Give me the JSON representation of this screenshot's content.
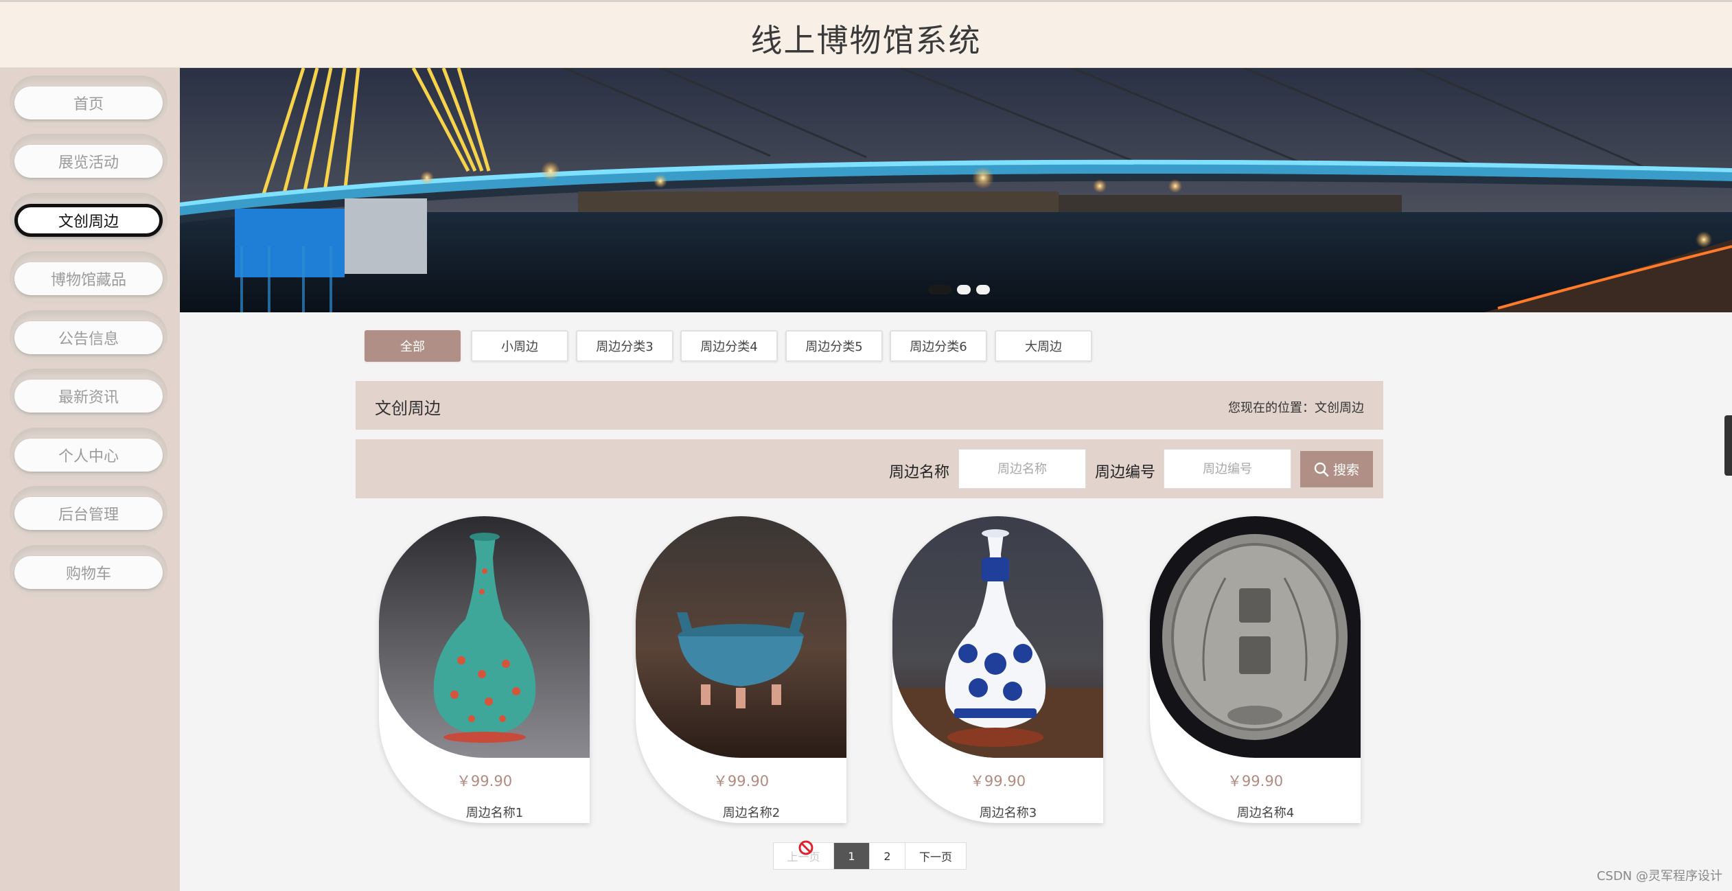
{
  "header": {
    "title": "线上博物馆系统"
  },
  "sidebar": {
    "items": [
      {
        "label": "首页",
        "active": false
      },
      {
        "label": "展览活动",
        "active": false
      },
      {
        "label": "文创周边",
        "active": true
      },
      {
        "label": "博物馆藏品",
        "active": false
      },
      {
        "label": "公告信息",
        "active": false
      },
      {
        "label": "最新资讯",
        "active": false
      },
      {
        "label": "个人中心",
        "active": false
      },
      {
        "label": "后台管理",
        "active": false
      },
      {
        "label": "购物车",
        "active": false
      }
    ]
  },
  "banner": {
    "slide_count": 3,
    "active_slide": 1
  },
  "tabs": [
    {
      "label": "全部",
      "active": true
    },
    {
      "label": "小周边",
      "active": false
    },
    {
      "label": "周边分类3",
      "active": false
    },
    {
      "label": "周边分类4",
      "active": false
    },
    {
      "label": "周边分类5",
      "active": false
    },
    {
      "label": "周边分类6",
      "active": false
    },
    {
      "label": "大周边",
      "active": false
    }
  ],
  "section": {
    "title": "文创周边",
    "breadcrumb": "您现在的位置：文创周边"
  },
  "search": {
    "name_label": "周边名称",
    "name_placeholder": "周边名称",
    "name_value": "",
    "code_label": "周边编号",
    "code_placeholder": "周边编号",
    "code_value": "",
    "button_label": "搜索"
  },
  "products": [
    {
      "price": "￥99.90",
      "name": "周边名称1",
      "image": "turquoise-vase"
    },
    {
      "price": "￥99.90",
      "name": "周边名称2",
      "image": "blue-tripod-censer"
    },
    {
      "price": "￥99.90",
      "name": "周边名称3",
      "image": "blue-white-porcelain-vase"
    },
    {
      "price": "￥99.90",
      "name": "周边名称4",
      "image": "silver-coin"
    }
  ],
  "pagination": {
    "prev": "上一页",
    "pages": [
      "1",
      "2"
    ],
    "current": "1",
    "next": "下一页"
  },
  "watermark": "CSDN @灵军程序设计",
  "colors": {
    "accent": "#b09086",
    "sidebar_bg": "#e2d4cc",
    "header_bg": "#f8f0e6",
    "price": "#b38a80"
  }
}
